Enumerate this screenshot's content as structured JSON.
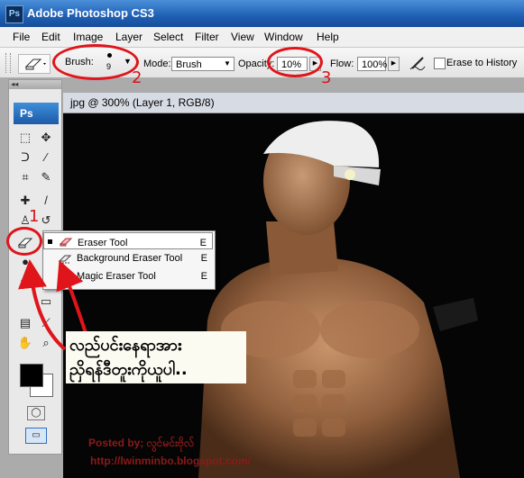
{
  "window": {
    "title": "Adobe Photoshop CS3",
    "app_icon": "Ps"
  },
  "menu": [
    "File",
    "Edit",
    "Image",
    "Layer",
    "Select",
    "Filter",
    "View",
    "Window",
    "Help"
  ],
  "options": {
    "brush_label": "Brush:",
    "brush_size": "9",
    "mode_label": "Mode:",
    "mode_value": "Brush",
    "opacity_label": "Opacity:",
    "opacity_value": "10%",
    "flow_label": "Flow:",
    "flow_value": "100%",
    "erase_history_label": "Erase to History"
  },
  "document": {
    "tab_title": "jpg @ 300% (Layer 1, RGB/8)"
  },
  "toolbox": {
    "logo": "Ps"
  },
  "flyout": [
    {
      "label": "Eraser Tool",
      "shortcut": "E",
      "selected": true
    },
    {
      "label": "Background Eraser Tool",
      "shortcut": "E",
      "selected": false
    },
    {
      "label": "Magic Eraser Tool",
      "shortcut": "E",
      "selected": false
    }
  ],
  "annotations": {
    "num1": "1",
    "num2": "2",
    "num3": "3"
  },
  "caption": {
    "line1": "လည်ပင်းနေရာအား",
    "line2": "ညှိရန်ဒီတူးကိုယူပါ.."
  },
  "credit": {
    "line1": "Posted by; လွင်မင်းဗိုလ်",
    "line2": "http://lwinminbo.blogspot.com/"
  },
  "colors": {
    "annotation_red": "#e0141b",
    "title_blue": "#1f5fb4",
    "credit_red": "#8b1a1a"
  }
}
